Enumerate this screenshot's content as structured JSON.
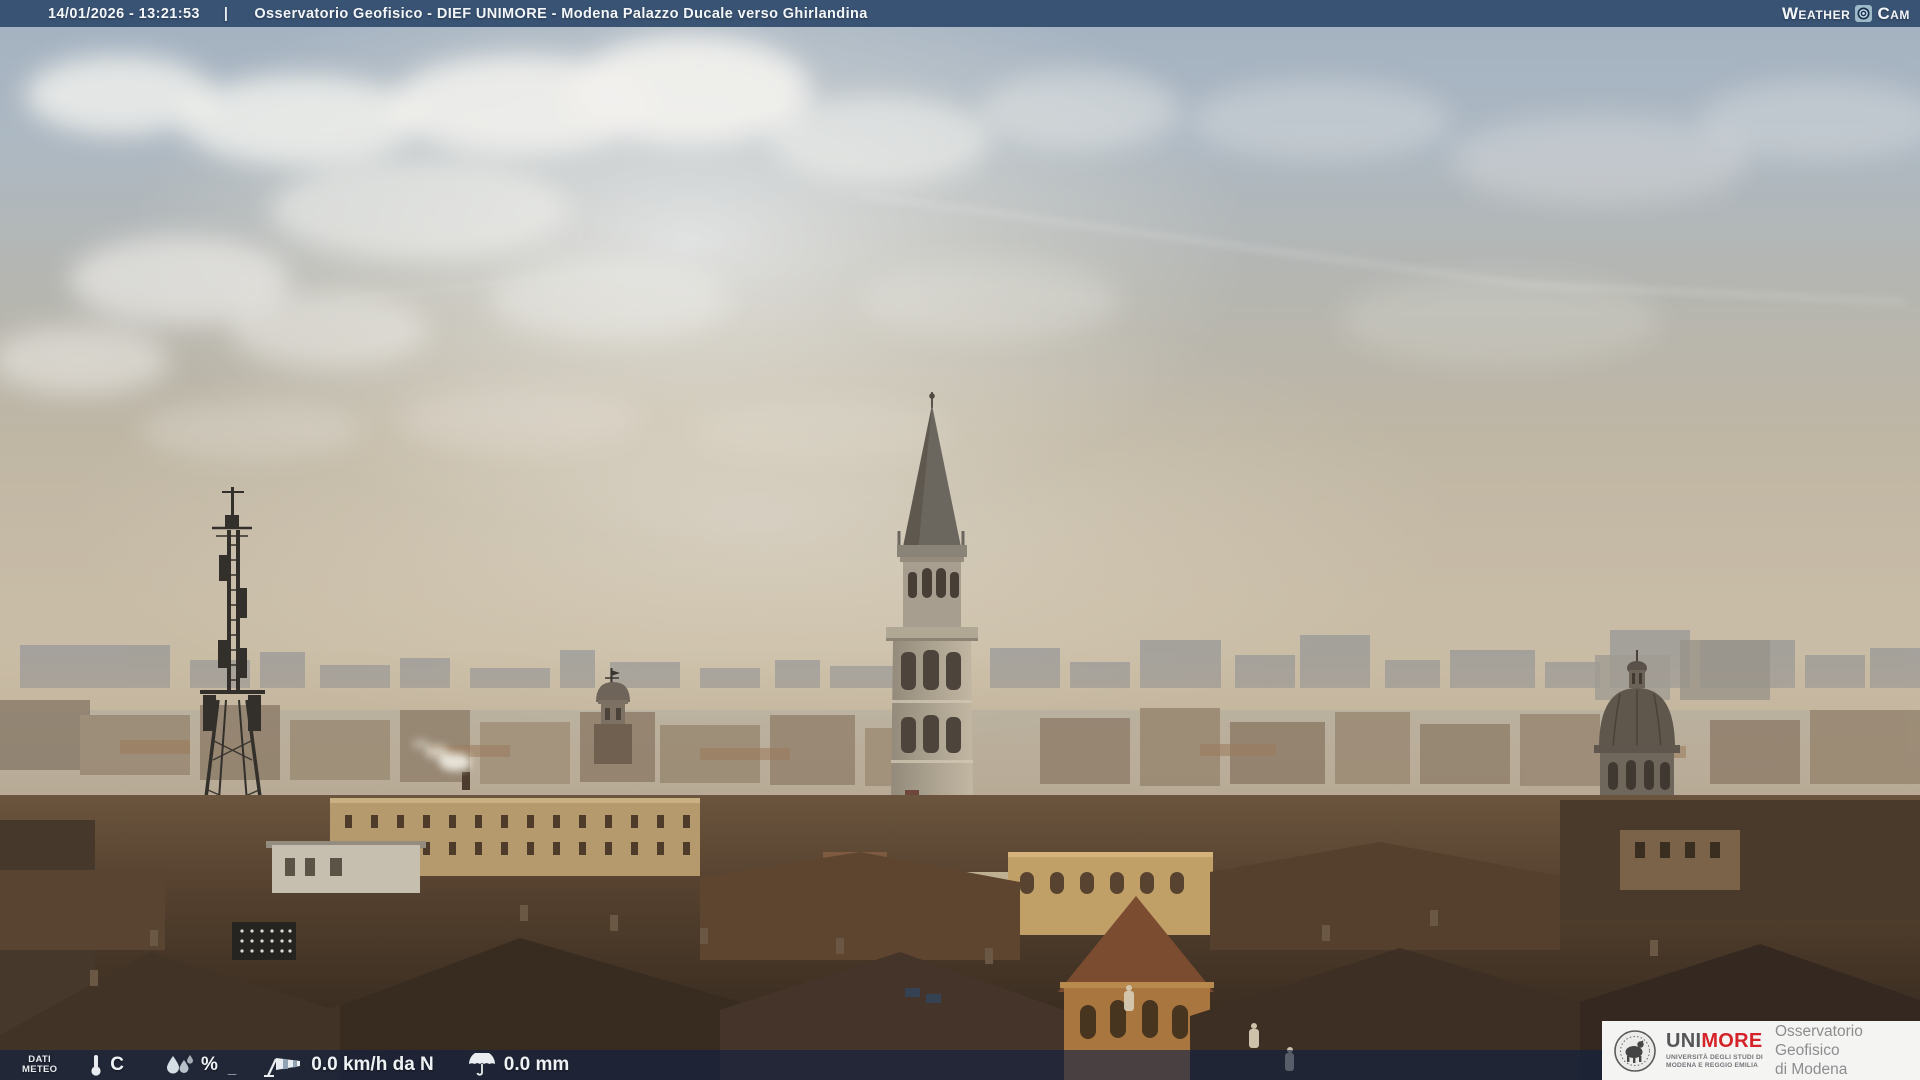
{
  "header": {
    "timestamp": "14/01/2026 - 13:21:53",
    "separator": "|",
    "title": "Osservatorio Geofisico - DIEF UNIMORE - Modena Palazzo Ducale verso Ghirlandina",
    "brand": {
      "w": "W",
      "eather": "EATHER",
      "c": "C",
      "am": "AM"
    }
  },
  "footer": {
    "label_line1": "DATI",
    "label_line2": "METEO",
    "temperature_unit": "C",
    "humidity_unit": "%",
    "humidity_missing": "_",
    "wind": "0.0 km/h da N",
    "precipitation": "0.0 mm"
  },
  "credit": {
    "brand_uni": "UNI",
    "brand_more": "MORE",
    "subtitle_line1": "UNIVERSITÀ DEGLI STUDI DI",
    "subtitle_line2": "MODENA E REGGIO EMILIA",
    "org_line1": "Osservatorio Geofisico",
    "org_line2": "di Modena"
  },
  "colors": {
    "header_bar": "#32506e",
    "footer_bar": "#122142",
    "brand_red": "#d5232a",
    "sky_top": "#a2b1c1",
    "haze_warm": "#c8bca6",
    "roof_dark": "#3a2d22"
  }
}
